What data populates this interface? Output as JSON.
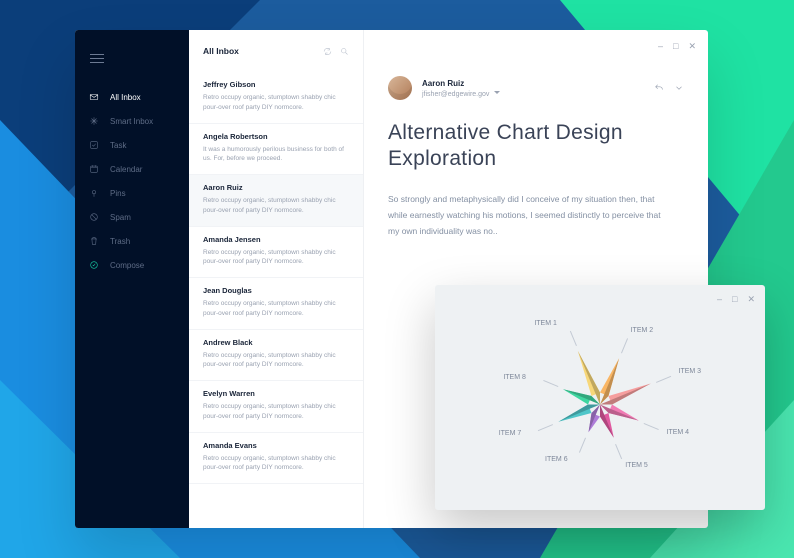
{
  "sidebar": {
    "items": [
      {
        "label": "All Inbox",
        "icon": "mail-icon",
        "active": true
      },
      {
        "label": "Smart Inbox",
        "icon": "sparkle-icon"
      },
      {
        "label": "Task",
        "icon": "check-icon"
      },
      {
        "label": "Calendar",
        "icon": "calendar-icon"
      },
      {
        "label": "Pins",
        "icon": "pin-icon"
      },
      {
        "label": "Spam",
        "icon": "spam-icon"
      },
      {
        "label": "Trash",
        "icon": "trash-icon"
      },
      {
        "label": "Compose",
        "icon": "compose-icon"
      }
    ]
  },
  "list": {
    "title": "All Inbox",
    "messages": [
      {
        "from": "Jeffrey Gibson",
        "preview": "Retro occupy organic, stumptown shabby chic pour-over roof party DIY normcore."
      },
      {
        "from": "Angela Robertson",
        "preview": "It was a humorously perilous business for both of us. For, before we proceed."
      },
      {
        "from": "Aaron Ruiz",
        "preview": "Retro occupy organic, stumptown shabby chic pour-over roof party DIY normcore.",
        "selected": true
      },
      {
        "from": "Amanda Jensen",
        "preview": "Retro occupy organic, stumptown shabby chic pour-over roof party DIY normcore."
      },
      {
        "from": "Jean Douglas",
        "preview": "Retro occupy organic, stumptown shabby chic pour-over roof party DIY normcore."
      },
      {
        "from": "Andrew Black",
        "preview": "Retro occupy organic, stumptown shabby chic pour-over roof party DIY normcore."
      },
      {
        "from": "Evelyn Warren",
        "preview": "Retro occupy organic, stumptown shabby chic pour-over roof party DIY normcore."
      },
      {
        "from": "Amanda Evans",
        "preview": "Retro occupy organic, stumptown shabby chic pour-over roof party DIY normcore."
      }
    ]
  },
  "reader": {
    "sender_name": "Aaron Ruiz",
    "sender_address": "jfisher@edgewire.gov",
    "subject": "Alternative Chart Design Exploration",
    "body": "So strongly and metaphysically did I conceive of my situation then, that while earnestly watching his motions, I seemed distinctly to perceive that my own individuality was no.."
  },
  "window": {
    "min": "–",
    "max": "□",
    "close": "✕"
  },
  "chart_data": {
    "type": "pie",
    "title": "",
    "categories": [
      "ITEM 1",
      "ITEM 2",
      "ITEM 3",
      "ITEM 4",
      "ITEM 5",
      "ITEM 6",
      "ITEM 7",
      "ITEM 8"
    ],
    "values": [
      1,
      1,
      1,
      1,
      1,
      1,
      1,
      1
    ],
    "colors": [
      "#f7d779",
      "#f9b665",
      "#f69e9e",
      "#f07bb4",
      "#e05aa0",
      "#ae7cd8",
      "#4fc6c9",
      "#3fd6a0"
    ]
  }
}
